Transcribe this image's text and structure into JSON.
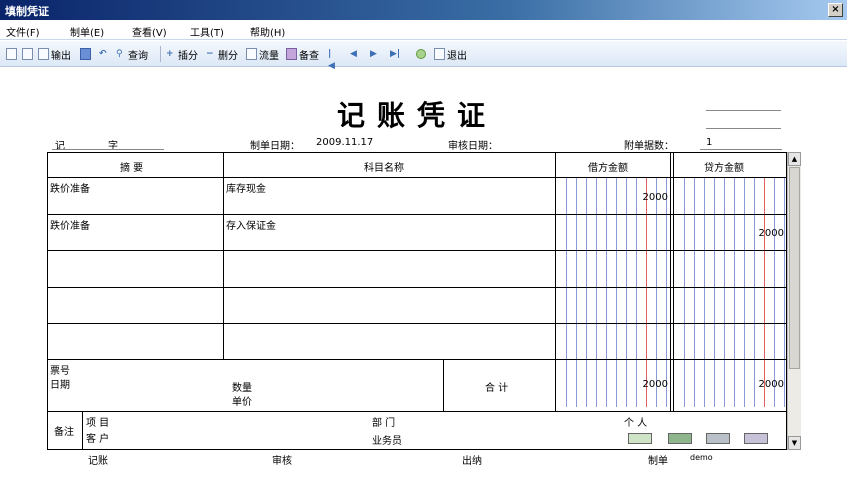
{
  "window": {
    "title": "填制凭证",
    "close_glyph": "×"
  },
  "menu": [
    {
      "label": "文件(F)"
    },
    {
      "label": "制单(E)"
    },
    {
      "label": "查看(V)"
    },
    {
      "label": "工具(T)"
    },
    {
      "label": "帮助(H)"
    }
  ],
  "toolbar": {
    "output": "输出",
    "query": "查询",
    "insert": "插分",
    "delete": "删分",
    "flow": "流量",
    "check": "备查",
    "exit": "退出"
  },
  "voucher": {
    "title": "记账凭证",
    "type_label": "记",
    "number_label": "字",
    "date_label": "制单日期：",
    "date_value": "2009.11.17",
    "audit_date_label": "审核日期：",
    "attach_label": "附单据数：",
    "attach_value": "1"
  },
  "columns": {
    "summary": "摘 要",
    "account": "科目名称",
    "debit": "借方金额",
    "credit": "贷方金额"
  },
  "entries": [
    {
      "summary": "跌价准备",
      "account": "库存现金",
      "debit": "2000",
      "credit": ""
    },
    {
      "summary": "跌价准备",
      "account": "存入保证金",
      "debit": "",
      "credit": "2000"
    }
  ],
  "footer_block": {
    "ticket_no": "票号",
    "date": "日期",
    "quantity": "数量",
    "unit_price": "单价",
    "total_label": "合 计",
    "debit_total": "2000",
    "credit_total": "2000"
  },
  "notes": {
    "label": "备注",
    "project": "项  目",
    "customer": "客  户",
    "department": "部  门",
    "salesperson": "业务员",
    "person": "个  人"
  },
  "signatures": {
    "bookkeeper": "记账",
    "auditor": "审核",
    "cashier": "出纳",
    "preparer": "制单",
    "preparer_name": "demo"
  }
}
